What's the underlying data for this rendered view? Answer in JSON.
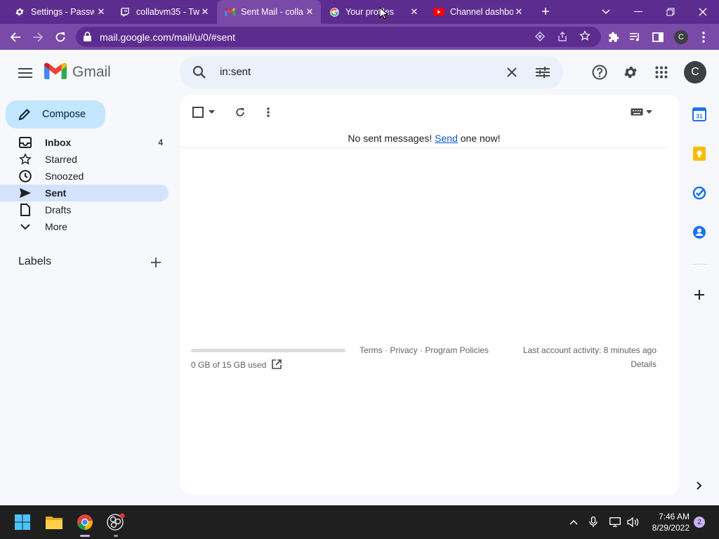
{
  "browser": {
    "tabs": [
      {
        "title": "Settings - Passw",
        "icon": "gear-icon"
      },
      {
        "title": "collabvm35 - Tw",
        "icon": "twitch-icon"
      },
      {
        "title": "Sent Mail - colla",
        "icon": "gmail-icon",
        "active": true
      },
      {
        "title": "Your profiles",
        "icon": "google-icon"
      },
      {
        "title": "Channel dashbo",
        "icon": "youtube-icon"
      }
    ],
    "url": "mail.google.com/mail/u/0/#sent",
    "profile_initial": "C",
    "accent": "#7a4aa8"
  },
  "gmail": {
    "brand": "Gmail",
    "search_query": "in:sent",
    "account_initial": "C",
    "compose_label": "Compose",
    "nav": [
      {
        "label": "Inbox",
        "count": "4",
        "icon": "inbox-icon"
      },
      {
        "label": "Starred",
        "count": "",
        "icon": "star-icon"
      },
      {
        "label": "Snoozed",
        "count": "",
        "icon": "clock-icon"
      },
      {
        "label": "Sent",
        "count": "",
        "icon": "send-icon"
      },
      {
        "label": "Drafts",
        "count": "",
        "icon": "draft-icon"
      },
      {
        "label": "More",
        "count": "",
        "icon": "chevron-down-icon"
      }
    ],
    "labels_heading": "Labels",
    "empty_prefix": "No sent messages! ",
    "empty_link": "Send",
    "empty_suffix": " one now!",
    "footer": {
      "storage": "0 GB of 15 GB used",
      "storage_fraction": 0,
      "policies": "Terms · Privacy · Program Policies",
      "activity": "Last account activity: 8 minutes ago",
      "details": "Details"
    },
    "calendar_day": "31"
  },
  "taskbar": {
    "time": "7:46 AM",
    "date": "8/29/2022",
    "notifications": "2"
  }
}
